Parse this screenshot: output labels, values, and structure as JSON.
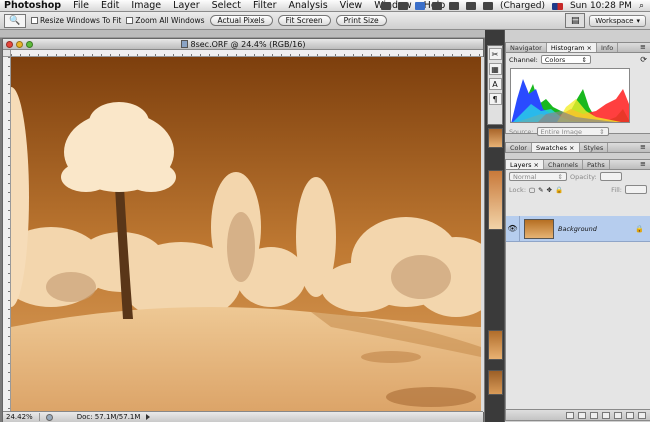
{
  "menubar": {
    "app": "Photoshop",
    "items": [
      "File",
      "Edit",
      "Image",
      "Layer",
      "Select",
      "Filter",
      "Analysis",
      "View",
      "Window",
      "Help"
    ],
    "battery": "(Charged)",
    "clock": "Sun 10:28 PM"
  },
  "options": {
    "resize_windows": "Resize Windows To Fit",
    "zoom_all": "Zoom All Windows",
    "actual_pixels": "Actual Pixels",
    "fit_screen": "Fit Screen",
    "print_size": "Print Size",
    "workspace": "Workspace"
  },
  "document": {
    "title": "8sec.ORF @ 24.4% (RGB/16)",
    "zoom": "24.42%",
    "doc_size": "Doc: 57.1M/57.1M"
  },
  "histogram": {
    "tabs": [
      "Navigator",
      "Histogram",
      "Info"
    ],
    "channel_label": "Channel:",
    "channel_value": "Colors",
    "source_label": "Source:",
    "source_value": "Entire Image"
  },
  "swatches": {
    "tabs": [
      "Color",
      "Swatches",
      "Styles"
    ]
  },
  "layers": {
    "tabs": [
      "Layers",
      "Channels",
      "Paths"
    ],
    "blend_mode": "Normal",
    "opacity_label": "Opacity:",
    "lock_label": "Lock:",
    "fill_label": "Fill:",
    "layer_name": "Background"
  },
  "colors": {
    "sky_top": "#8a4a14",
    "sky_bottom": "#c9873e",
    "foliage": "#f6dcb8",
    "ground": "#e8bb80",
    "layer_selected": "#b6cdee"
  }
}
